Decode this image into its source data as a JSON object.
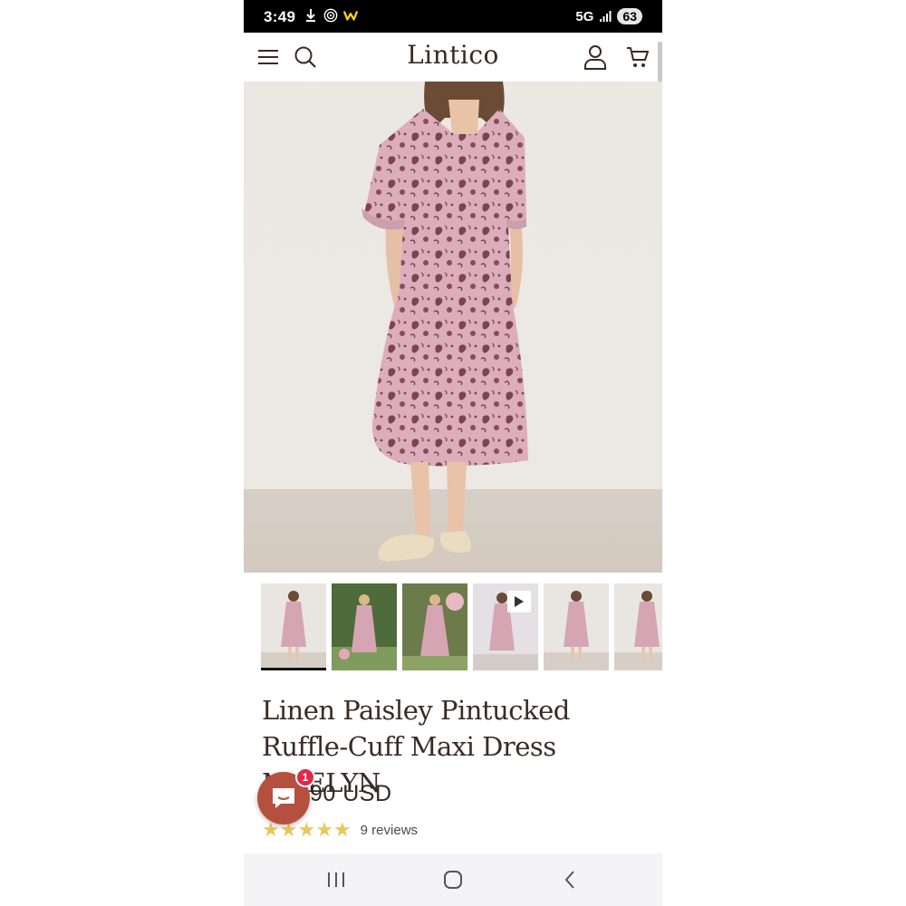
{
  "status_bar": {
    "time": "3:49",
    "network": "5G",
    "battery": "63",
    "icons": [
      "download-icon",
      "vpn-icon",
      "w-app-icon",
      "signal-icon"
    ]
  },
  "header": {
    "logo": "Lintico",
    "icons": [
      "menu-icon",
      "search-icon",
      "account-icon",
      "cart-icon"
    ]
  },
  "gallery": {
    "thumbnails": [
      {
        "scene": "studio",
        "active": true
      },
      {
        "scene": "garden",
        "active": false
      },
      {
        "scene": "garden",
        "active": false
      },
      {
        "scene": "studio-video",
        "active": false,
        "video": true
      },
      {
        "scene": "studio",
        "active": false
      },
      {
        "scene": "studio",
        "active": false
      }
    ]
  },
  "product": {
    "title": "Linen Paisley Pintucked Ruffle-Cuff Maxi Dress MAELYN",
    "price": "90 USD",
    "rating_stars": 5,
    "reviews": "9 reviews"
  },
  "chat": {
    "badge": "1"
  },
  "nav_bar": {
    "icons": [
      "recent-apps-icon",
      "home-icon",
      "back-icon"
    ]
  },
  "colors": {
    "dress": "#d9a9b8",
    "paisley": "#7d4350",
    "star": "#e9c75a",
    "chat": "#b5503f",
    "badge": "#e4284a"
  }
}
